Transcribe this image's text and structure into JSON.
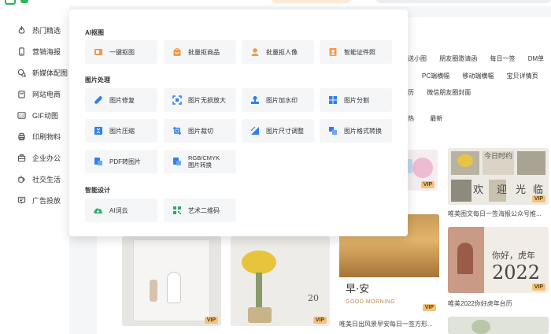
{
  "sidebar": {
    "items": [
      {
        "label": "热门精选",
        "icon": "flame-icon"
      },
      {
        "label": "营销海报",
        "icon": "phone-icon"
      },
      {
        "label": "新媒体配图",
        "icon": "chat-icon"
      },
      {
        "label": "网站电商",
        "icon": "bag-icon"
      },
      {
        "label": "GIF动图",
        "icon": "gif-icon"
      },
      {
        "label": "印刷物料",
        "icon": "print-icon"
      },
      {
        "label": "企业办公",
        "icon": "briefcase-icon"
      },
      {
        "label": "社交生活",
        "icon": "cup-icon"
      },
      {
        "label": "广告投放",
        "icon": "billboard-icon"
      }
    ]
  },
  "dropdown": {
    "sections": [
      {
        "title": "AI抠图",
        "tools": [
          {
            "label": "一键抠图",
            "icon": "cutout-icon",
            "color": "#f2994a"
          },
          {
            "label": "批量抠商品",
            "icon": "bag-cutout-icon",
            "color": "#f2994a"
          },
          {
            "label": "批量抠人像",
            "icon": "person-cutout-icon",
            "color": "#f2994a"
          },
          {
            "label": "智能证件照",
            "icon": "id-photo-icon",
            "color": "#f2994a"
          }
        ]
      },
      {
        "title": "图片处理",
        "tools": [
          {
            "label": "图片修复",
            "icon": "wrench-icon",
            "color": "#2f80ed"
          },
          {
            "label": "图片无损放大",
            "icon": "expand-icon",
            "color": "#2f80ed"
          },
          {
            "label": "图片加水印",
            "icon": "watermark-icon",
            "color": "#2f80ed"
          },
          {
            "label": "图片分割",
            "icon": "grid-split-icon",
            "color": "#2f80ed"
          },
          {
            "label": "图片压缩",
            "icon": "compress-icon",
            "color": "#2f80ed"
          },
          {
            "label": "图片裁切",
            "icon": "crop-icon",
            "color": "#2f80ed"
          },
          {
            "label": "图片尺寸调整",
            "icon": "resize-icon",
            "color": "#2f80ed"
          },
          {
            "label": "图片格式转换",
            "icon": "format-convert-icon",
            "color": "#2f80ed"
          },
          {
            "label": "PDF转图片",
            "icon": "pdf-icon",
            "color": "#2f80ed"
          },
          {
            "label": "RGB/CMYK",
            "label2": "图片转换",
            "icon": "rgb-cmyk-icon",
            "color": "#2f80ed"
          }
        ]
      },
      {
        "title": "智能设计",
        "tools": [
          {
            "label": "AI词云",
            "icon": "cloud-icon",
            "color": "#27ae60"
          },
          {
            "label": "艺术二维码",
            "icon": "qrcode-icon",
            "color": "#27ae60"
          }
        ]
      }
    ]
  },
  "filters": {
    "row1": [
      "送小图",
      "朋友圈邀请函",
      "每日一签",
      "DM单"
    ],
    "row2": [
      "PC端横幅",
      "移动端横幅",
      "宝贝详情页"
    ],
    "row3": [
      "历",
      "微信朋友圈封面"
    ],
    "row4": [
      "热",
      "最新"
    ]
  },
  "cards": {
    "vip_label": "VIP",
    "caption_right1": "唯美图文每日一签海报公众号推...",
    "caption_right2": "唯美2022你好虎年台历",
    "caption_mid": "唯美日出风景早安每日一签方形...",
    "card_title_zaoan": "早·安",
    "card_good_morning": "GOOD MORNING",
    "card_nihao": "你好，虎年",
    "card_2022": "2022",
    "card_jinri": "今日时约",
    "card_huan": "欢",
    "card_ying": "迎",
    "card_guang": "光",
    "card_lin": "临",
    "card_20": "20"
  }
}
